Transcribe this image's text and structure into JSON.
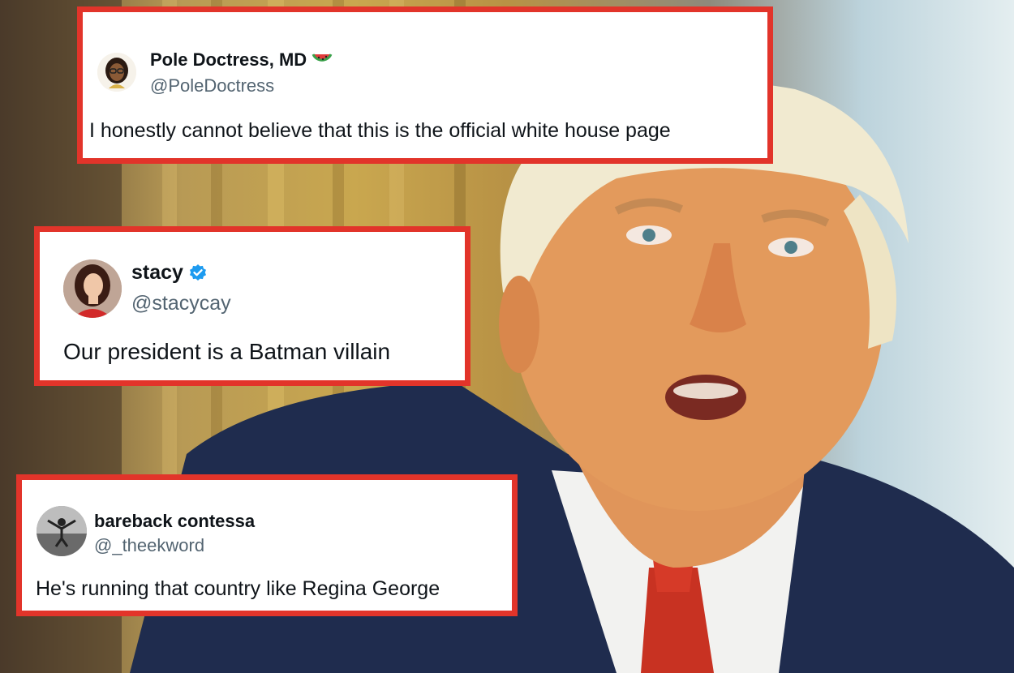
{
  "tweets": [
    {
      "display_name": "Pole Doctress, MD",
      "handle": "@PoleDoctress",
      "text": "I honestly cannot believe that this is the official white house page",
      "name_emoji": "watermelon-icon",
      "verified": false
    },
    {
      "display_name": "stacy",
      "handle": "@stacycay",
      "text": "Our president is a Batman villain",
      "verified": true
    },
    {
      "display_name": "bareback contessa",
      "handle": "@_theekword",
      "text": "He's running that country like Regina George",
      "verified": false
    }
  ],
  "colors": {
    "frame": "#e2342a",
    "verified": "#1d9bf0",
    "handle": "#536471",
    "text": "#0f1419"
  }
}
